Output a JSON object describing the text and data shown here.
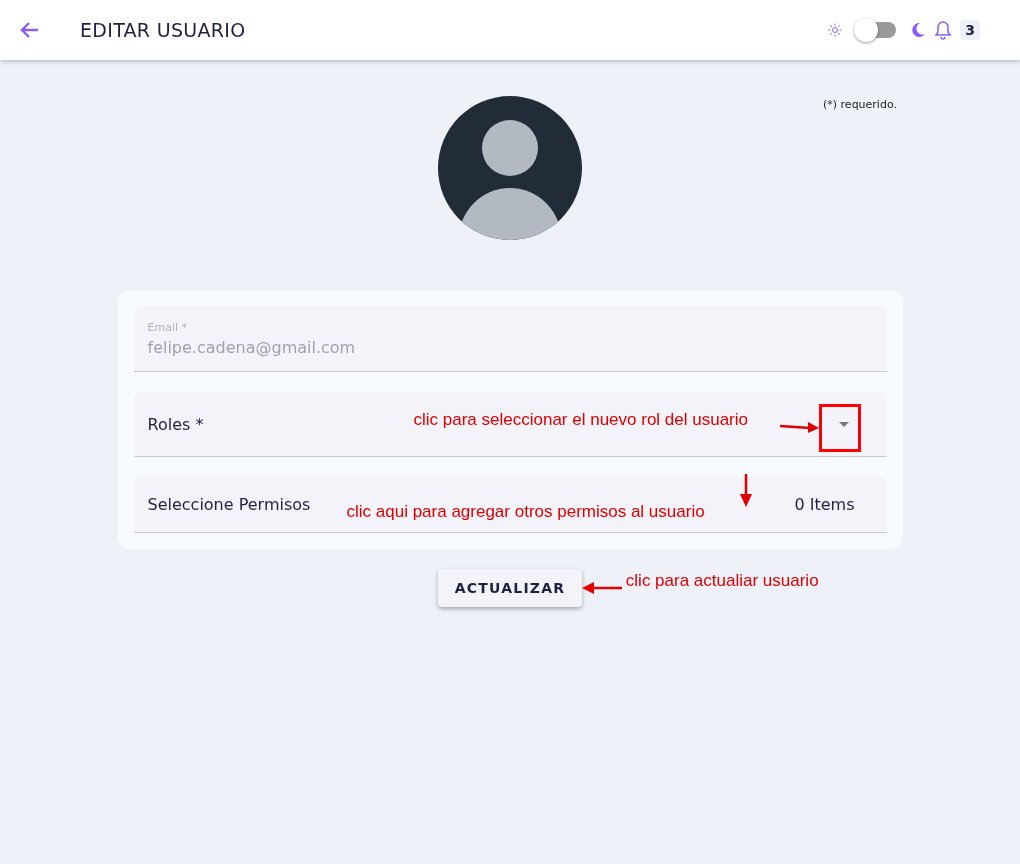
{
  "header": {
    "title": "EDITAR USUARIO",
    "dark_mode": {
      "on": false
    },
    "notifications": "3"
  },
  "required_note": "(*) requerido.",
  "form": {
    "fields": [
      {
        "kind": "text",
        "label": "Email *",
        "value": "felipe.cadena@gmail.com",
        "disabled": true
      },
      {
        "kind": "select",
        "label": "Roles *",
        "annotation": "clic para seleccionar el nuevo rol del usuario"
      },
      {
        "kind": "multi",
        "label": "Seleccione Permisos",
        "count": "0 Items",
        "annotation": "clic aqui para agregar otros permisos al usuario"
      }
    ]
  },
  "submit": {
    "label": "ACTUALIZAR",
    "annotation": "clic para actualiar usuario"
  }
}
